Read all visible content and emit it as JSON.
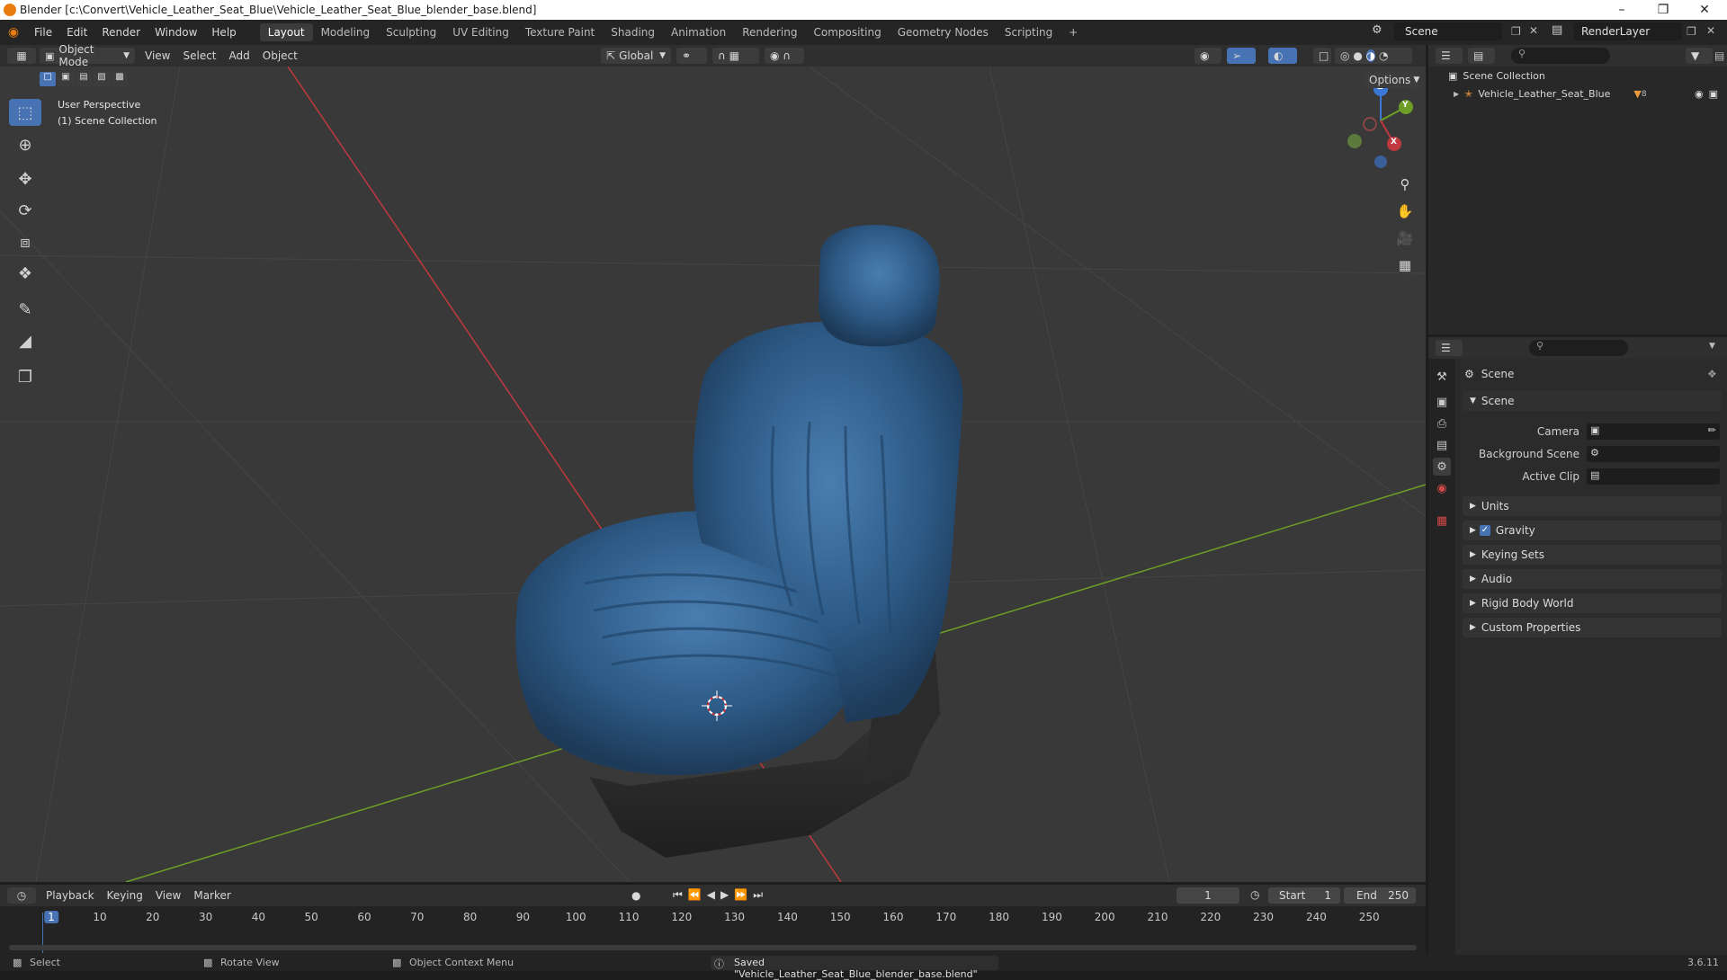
{
  "window": {
    "title": "Blender [c:\\Convert\\Vehicle_Leather_Seat_Blue\\Vehicle_Leather_Seat_Blue_blender_base.blend]"
  },
  "menu": {
    "items": [
      "File",
      "Edit",
      "Render",
      "Window",
      "Help"
    ]
  },
  "workspaces": {
    "tabs": [
      "Layout",
      "Modeling",
      "Sculpting",
      "UV Editing",
      "Texture Paint",
      "Shading",
      "Animation",
      "Rendering",
      "Compositing",
      "Geometry Nodes",
      "Scripting"
    ],
    "active": "Layout",
    "add": "+"
  },
  "top_right": {
    "scene": "Scene",
    "view_layer": "RenderLayer"
  },
  "viewport": {
    "mode": "Object Mode",
    "menus": [
      "View",
      "Select",
      "Add",
      "Object"
    ],
    "orientation": "Global",
    "options": "Options",
    "overlay_line1": "User Perspective",
    "overlay_line2": "(1) Scene Collection",
    "gizmo": {
      "x": "X",
      "y": "Y",
      "z": "Z"
    }
  },
  "toolbar": {
    "tools": [
      "select-box",
      "cursor",
      "move",
      "rotate",
      "scale",
      "transform",
      "annotate",
      "measure",
      "add-cube"
    ],
    "active": "select-box"
  },
  "outliner": {
    "root": "Scene Collection",
    "object": "Vehicle_Leather_Seat_Blue",
    "object_badge": "8"
  },
  "properties": {
    "header": "Scene",
    "section": "Scene",
    "fields": [
      {
        "label": "Camera",
        "value": ""
      },
      {
        "label": "Background Scene",
        "value": ""
      },
      {
        "label": "Active Clip",
        "value": ""
      }
    ],
    "panels": [
      "Units",
      "Gravity",
      "Keying Sets",
      "Audio",
      "Rigid Body World",
      "Custom Properties"
    ],
    "gravity_checked": true
  },
  "timeline": {
    "menus": [
      "Playback",
      "Keying",
      "View",
      "Marker"
    ],
    "current_frame": "1",
    "start_label": "Start",
    "start": "1",
    "end_label": "End",
    "end": "250",
    "ticks": [
      "1",
      "10",
      "20",
      "30",
      "40",
      "50",
      "60",
      "70",
      "80",
      "90",
      "100",
      "110",
      "120",
      "130",
      "140",
      "150",
      "160",
      "170",
      "180",
      "190",
      "200",
      "210",
      "220",
      "230",
      "240",
      "250"
    ]
  },
  "statusbar": {
    "select": "Select",
    "rotate": "Rotate View",
    "context": "Object Context Menu",
    "message": "Saved \"Vehicle_Leather_Seat_Blue_blender_base.blend\"",
    "version": "3.6.11"
  },
  "colors": {
    "accent": "#4772b3",
    "seat_blue": "#2d5a86",
    "x_axis": "#c0393f",
    "y_axis": "#6e9e25",
    "z_axis": "#3b77d6"
  }
}
